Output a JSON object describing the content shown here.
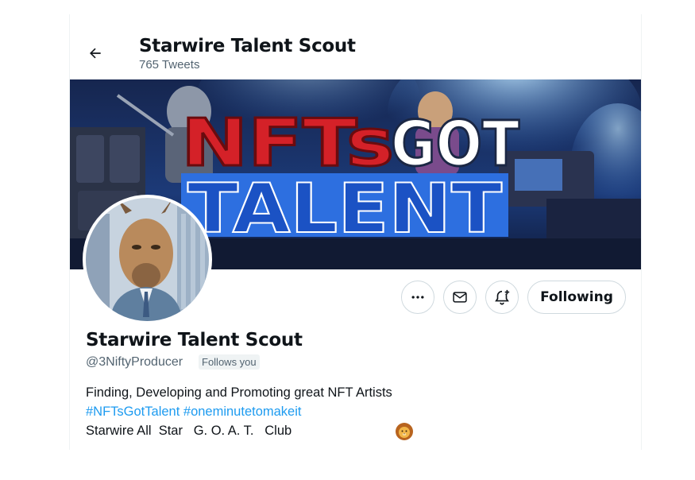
{
  "header": {
    "title": "Starwire Talent Scout",
    "tweet_count": "765 Tweets"
  },
  "banner": {
    "line1_red": "NFTs",
    "line1_white": "GOT",
    "line2": "TALENT"
  },
  "actions": {
    "more_icon": "more-icon",
    "message_icon": "envelope-icon",
    "notify_icon": "bell-plus-icon",
    "following_label": "Following"
  },
  "profile": {
    "name": "Starwire Talent Scout",
    "handle": "@3NiftyProducer",
    "follows_you": "Follows you",
    "bio": {
      "line1": "Finding, Developing and Promoting great NFT Artists",
      "hashtags": [
        "#NFTsGotTalent",
        "#oneminutetomakeit"
      ],
      "line3": "Starwire All  Star   G. O. A. T.   Club",
      "emoji": "lion-face-icon"
    }
  },
  "colors": {
    "accent": "#1d9bf0",
    "text": "#0f1419",
    "muted": "#536471",
    "banner_red": "#d42128",
    "banner_blue": "#2d6fe0"
  }
}
